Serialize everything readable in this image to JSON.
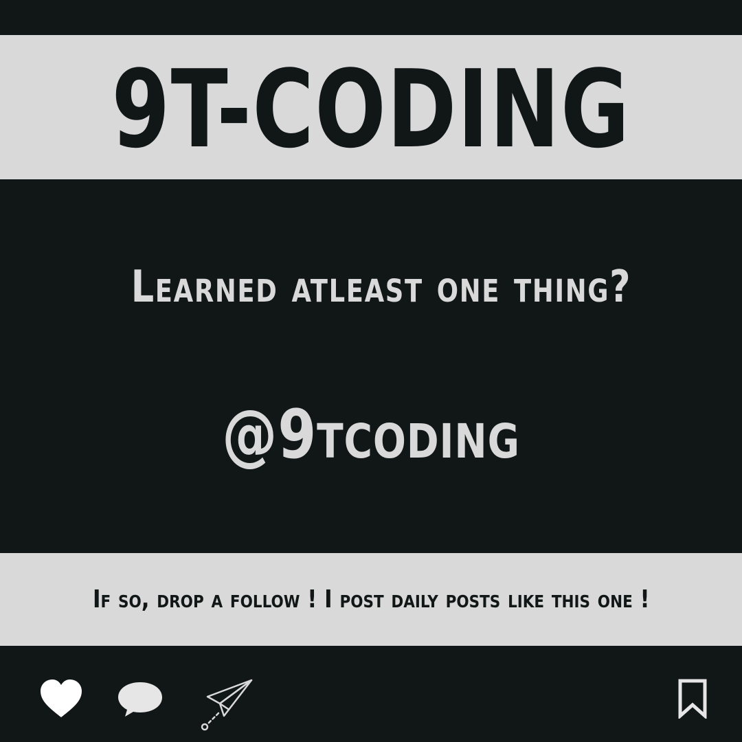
{
  "header": {
    "brand": "9T-CODING"
  },
  "main": {
    "question": "Learned atleast one thing?",
    "handle": "@9tcoding"
  },
  "footer": {
    "cta": "If so, drop a follow ! I post daily posts like this one !"
  },
  "actions": {
    "icons": [
      "heart-icon",
      "comment-icon",
      "send-icon",
      "bookmark-icon"
    ]
  },
  "colors": {
    "background": "#111616",
    "band": "#d9d9d9",
    "text_dark": "#111616",
    "text_light": "#d9d9d9"
  }
}
